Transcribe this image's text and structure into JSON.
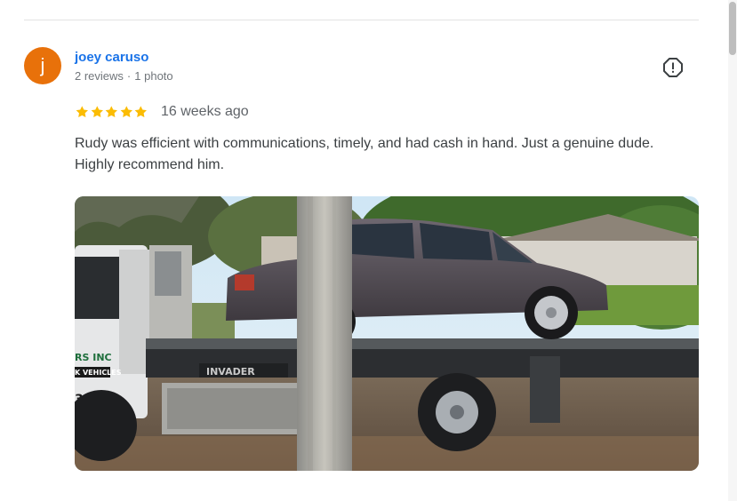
{
  "review": {
    "avatar_initial": "j",
    "avatar_color": "#e8710a",
    "author_name": "joey caruso",
    "reviews_count": "2 reviews",
    "meta_separator": "·",
    "photos_count": "1 photo",
    "rating": 5,
    "rating_max": 5,
    "star_color": "#fbbc04",
    "time_ago": "16 weeks ago",
    "text": "Rudy was efficient with communications, timely, and had cash in hand. Just a genuine dude. Highly recommend him.",
    "report_icon": "flag-alert-icon",
    "photo": {
      "description_icon": "review-photo",
      "truck_brand_text": "INVADER",
      "decal_line1": "RS INC",
      "decal_line2": "K VEHICLES",
      "decal_line3": "331"
    }
  },
  "colors": {
    "link": "#1a73e8",
    "muted": "#70757a",
    "body_text": "#3c4043"
  }
}
